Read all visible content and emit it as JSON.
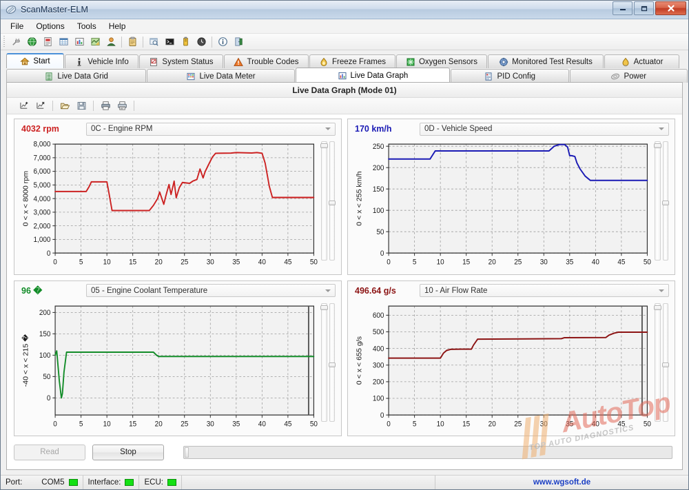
{
  "window": {
    "title": "ScanMaster-ELM",
    "icon": "app-scanner-icon",
    "minimize_label": "–",
    "maximize_label": "❐",
    "close_label": "✕"
  },
  "menu": {
    "items": [
      "File",
      "Options",
      "Tools",
      "Help"
    ]
  },
  "toolbar": {
    "buttons": [
      {
        "name": "connect-icon",
        "glyph": "⚒"
      },
      {
        "name": "globe-icon",
        "glyph": "ἱ0"
      },
      {
        "name": "report-icon",
        "glyph": "⌸"
      },
      {
        "name": "grid-icon",
        "glyph": "▦"
      },
      {
        "name": "chart-icon",
        "glyph": "ὌA"
      },
      {
        "name": "map-icon",
        "glyph": "⛳"
      },
      {
        "name": "user-icon",
        "glyph": "὆4"
      },
      {
        "name": "clipboard-icon",
        "glyph": "ὌB"
      },
      {
        "name": "window-icon",
        "glyph": "❐"
      },
      {
        "name": "terminal-icon",
        "glyph": "▶"
      },
      {
        "name": "battery-icon",
        "glyph": "ὐB"
      },
      {
        "name": "clock-icon",
        "glyph": "⏱"
      },
      {
        "name": "info-icon",
        "glyph": "ℹ"
      },
      {
        "name": "exit-icon",
        "glyph": "⏏"
      }
    ]
  },
  "tabs_row1": [
    {
      "label": "Start",
      "icon": "home-icon",
      "active": true
    },
    {
      "label": "Vehicle Info",
      "icon": "info-pillar-icon",
      "active": false
    },
    {
      "label": "System Status",
      "icon": "status-doc-icon",
      "active": false
    },
    {
      "label": "Trouble Codes",
      "icon": "warning-triangle-icon",
      "active": false
    },
    {
      "label": "Freeze Frames",
      "icon": "freeze-flame-icon",
      "active": false
    },
    {
      "label": "Oxygen Sensors",
      "icon": "oxygen-grid-icon",
      "active": false
    },
    {
      "label": "Monitored Test Results",
      "icon": "gear-circle-icon",
      "active": false
    },
    {
      "label": "Actuator",
      "icon": "actuator-icon",
      "active": false
    }
  ],
  "tabs_row2": [
    {
      "label": "Live Data Grid",
      "icon": "list-icon",
      "active": false
    },
    {
      "label": "Live Data Meter",
      "icon": "meter-icon",
      "active": false
    },
    {
      "label": "Live Data Graph",
      "icon": "graph-icon",
      "active": true
    },
    {
      "label": "PID Config",
      "icon": "pid-config-icon",
      "active": false
    },
    {
      "label": "Power",
      "icon": "power-icon",
      "active": false
    }
  ],
  "panel": {
    "header_title": "Live Data Graph (Mode 01)",
    "toolbar_buttons": [
      {
        "name": "add-graph-icon"
      },
      {
        "name": "remove-graph-icon"
      },
      {
        "name": "open-file-icon"
      },
      {
        "name": "save-file-icon"
      },
      {
        "name": "print-icon"
      },
      {
        "name": "print-preview-icon"
      }
    ]
  },
  "chart_data": [
    {
      "type": "line",
      "panel_index": 0,
      "value_readout": "4032 rpm",
      "pid_label": "0C - Engine RPM",
      "color": "#cc2222",
      "title": "",
      "xlabel": "",
      "ylabel": "0 < x < 8000 rpm",
      "xlim": [
        0,
        50
      ],
      "ylim": [
        0,
        8000
      ],
      "yticks": [
        0,
        1000,
        2000,
        3000,
        4000,
        5000,
        6000,
        7000,
        8000
      ],
      "ytick_labels": [
        "0",
        "1,000",
        "2,000",
        "3,000",
        "4,000",
        "5,000",
        "6,000",
        "7,000",
        "8,000"
      ],
      "xticks": [
        0,
        5,
        10,
        15,
        20,
        25,
        30,
        35,
        40,
        45,
        50
      ],
      "grid": true,
      "cursor_x": null,
      "x": [
        0,
        6,
        6.6,
        7,
        10,
        10.4,
        11,
        18.2,
        19,
        19.8,
        20.2,
        21,
        21.4,
        22,
        22.4,
        23,
        23.4,
        24,
        24.6,
        26,
        26.6,
        27.4,
        28,
        28.6,
        29,
        29.6,
        30.4,
        31,
        31.4,
        34,
        35,
        38,
        39,
        40,
        40.6,
        41.4,
        42,
        50
      ],
      "y": [
        4520,
        4520,
        4900,
        5230,
        5230,
        4400,
        3120,
        3120,
        3500,
        4000,
        4480,
        3580,
        4200,
        5030,
        4300,
        5280,
        4060,
        4800,
        5180,
        5120,
        5280,
        5400,
        6170,
        5520,
        5980,
        6450,
        7050,
        7320,
        7330,
        7340,
        7380,
        7350,
        7380,
        7330,
        6600,
        4900,
        4080,
        4080
      ]
    },
    {
      "type": "line",
      "panel_index": 1,
      "value_readout": "170 km/h",
      "pid_label": "0D - Vehicle Speed",
      "color": "#1a1ab4",
      "title": "",
      "xlabel": "",
      "ylabel": "0 < x < 255 km/h",
      "xlim": [
        0,
        50
      ],
      "ylim": [
        0,
        255
      ],
      "yticks": [
        0,
        50,
        100,
        150,
        200,
        250
      ],
      "ytick_labels": [
        "0",
        "50",
        "100",
        "150",
        "200",
        "250"
      ],
      "xticks": [
        0,
        5,
        10,
        15,
        20,
        25,
        30,
        35,
        40,
        45,
        50
      ],
      "grid": true,
      "cursor_x": null,
      "x": [
        0,
        8,
        9,
        31,
        32,
        33,
        34,
        34.6,
        35,
        35.4,
        36,
        36.4,
        37,
        38,
        39,
        50
      ],
      "y": [
        220,
        220,
        239,
        239,
        250,
        254,
        254,
        248,
        228,
        228,
        226,
        211,
        197,
        180,
        170,
        170
      ]
    },
    {
      "type": "line",
      "panel_index": 2,
      "value_readout": "96 �",
      "pid_label": "05 - Engine Coolant Temperature",
      "color": "#128c28",
      "title": "",
      "xlabel": "",
      "ylabel": "-40 < x < 215 �",
      "xlim": [
        0,
        50
      ],
      "ylim": [
        -40,
        215
      ],
      "yticks": [
        0,
        50,
        100,
        150,
        200
      ],
      "ytick_labels": [
        "0",
        "50",
        "100",
        "150",
        "200"
      ],
      "xticks": [
        0,
        5,
        10,
        15,
        20,
        25,
        30,
        35,
        40,
        45,
        50
      ],
      "grid": true,
      "cursor_x": 49,
      "x": [
        0,
        0.3,
        0.8,
        1.2,
        1.4,
        1.7,
        2.2,
        19,
        19.6,
        20,
        50
      ],
      "y": [
        100,
        110,
        40,
        0,
        10,
        60,
        107,
        107,
        100,
        97,
        97
      ]
    },
    {
      "type": "line",
      "panel_index": 3,
      "value_readout": "496.64 g/s",
      "pid_label": "10 - Air Flow Rate",
      "color": "#8c1414",
      "title": "",
      "xlabel": "",
      "ylabel": "0 < x < 655 g/s",
      "xlim": [
        0,
        50
      ],
      "ylim": [
        0,
        655
      ],
      "yticks": [
        0,
        100,
        200,
        300,
        400,
        500,
        600
      ],
      "ytick_labels": [
        "0",
        "100",
        "200",
        "300",
        "400",
        "500",
        "600"
      ],
      "xticks": [
        0,
        5,
        10,
        15,
        20,
        25,
        30,
        35,
        40,
        45,
        50
      ],
      "grid": true,
      "cursor_x": 49,
      "x": [
        0,
        10,
        10.6,
        11.2,
        12,
        14,
        16,
        16.4,
        17.2,
        33.4,
        34,
        42,
        42.6,
        43.6,
        44.4,
        50
      ],
      "y": [
        342,
        342,
        372,
        388,
        395,
        396,
        396,
        420,
        456,
        459,
        465,
        466,
        480,
        492,
        498,
        498
      ]
    }
  ],
  "bottom": {
    "read_label": "Read",
    "read_enabled": false,
    "stop_label": "Stop",
    "stop_enabled": true,
    "progress_value": 0
  },
  "statusbar": {
    "port_label": "Port:",
    "port_value": "COM5",
    "port_led": "#14e014",
    "interface_label": "Interface:",
    "interface_led": "#14e014",
    "ecu_label": "ECU:",
    "ecu_led": "#14e014",
    "link": "www.wgsoft.de"
  },
  "watermark": {
    "main": "AutoTop",
    "sub": "TOP AUTO DIAGNOSTICS"
  }
}
